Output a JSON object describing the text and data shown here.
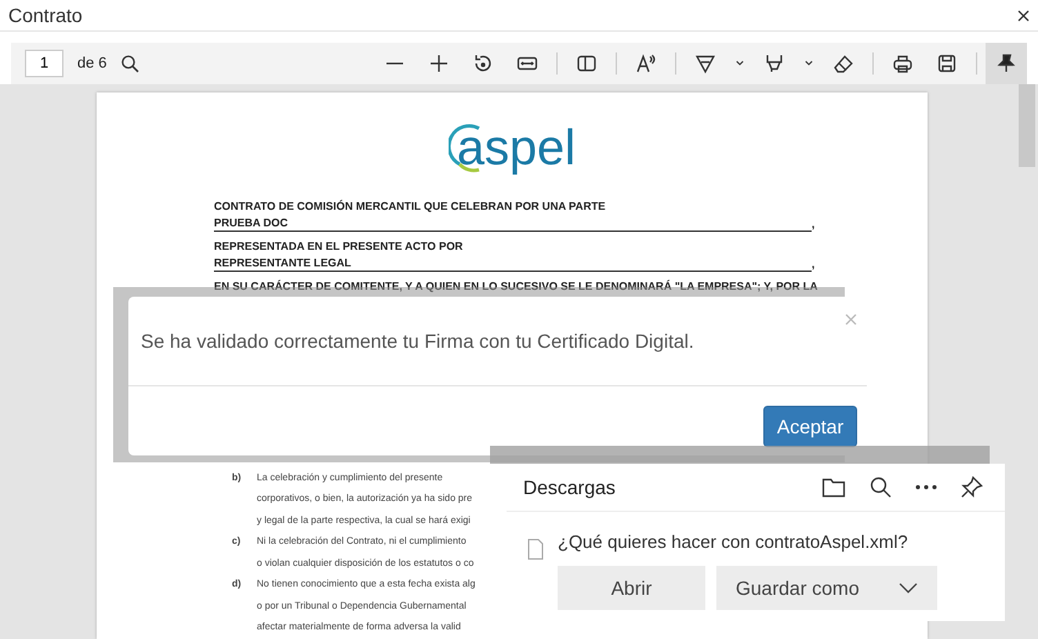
{
  "window": {
    "title": "Contrato"
  },
  "toolbar": {
    "page": "1",
    "page_count": "de 6",
    "tools": [
      {
        "kind": "minus",
        "selected": false
      },
      {
        "kind": "plus",
        "selected": false
      },
      {
        "kind": "rotate",
        "selected": false
      },
      {
        "kind": "fit",
        "selected": false
      },
      {
        "kind": "sep"
      },
      {
        "kind": "pageview",
        "selected": false
      },
      {
        "kind": "sep"
      },
      {
        "kind": "aloud",
        "selected": false
      },
      {
        "kind": "sep"
      },
      {
        "kind": "draw",
        "selected": false
      },
      {
        "kind": "chevron",
        "selected": false
      },
      {
        "kind": "highlight",
        "selected": false
      },
      {
        "kind": "chevron",
        "selected": false
      },
      {
        "kind": "eraser",
        "selected": false
      },
      {
        "kind": "sep"
      },
      {
        "kind": "print",
        "selected": false
      },
      {
        "kind": "save",
        "selected": false
      },
      {
        "kind": "sep"
      },
      {
        "kind": "pin",
        "selected": true
      }
    ]
  },
  "document": {
    "logo": "aspel",
    "heading": [
      {
        "kind": "plain",
        "text": "CONTRATO DE COMISIÓN MERCANTIL QUE CELEBRAN POR UNA PARTE"
      },
      {
        "kind": "blank",
        "text": "PRUEBA DOC",
        "end": ","
      },
      {
        "kind": "plain",
        "text": "REPRESENTADA EN EL PRESENTE ACTO POR"
      },
      {
        "kind": "blank",
        "text": "REPRESENTANTE LEGAL",
        "end": ","
      },
      {
        "kind": "plain",
        "text": "EN SU CARÁCTER DE COMITENTE, Y A QUIEN EN LO SUCESIVO SE LE DENOMINARÁ \"LA EMPRESA\"; Y, POR LA"
      }
    ],
    "items": [
      {
        "marker": "b)",
        "lines": [
          "La celebración y cumplimiento del presente",
          "corporativos, o bien, la autorización ya ha sido pre",
          "y legal de la parte respectiva, la cual se hará exigi"
        ]
      },
      {
        "marker": "c)",
        "lines": [
          "Ni la celebración del Contrato, ni el cumplimiento",
          "o violan cualquier disposición de los estatutos o co"
        ]
      },
      {
        "marker": "d)",
        "lines": [
          "No tienen conocimiento que a esta fecha exista alg",
          "o por un Tribunal o Dependencia Gubernamental",
          "afectar materialmente de forma adversa la valid"
        ]
      }
    ]
  },
  "dialog": {
    "message": "Se ha validado correctamente tu Firma con tu Certificado Digital.",
    "button": "Aceptar"
  },
  "downloads": {
    "title": "Descargas",
    "question": "¿Qué quieres hacer con contratoAspel.xml?",
    "open": "Abrir",
    "save": "Guardar como"
  }
}
